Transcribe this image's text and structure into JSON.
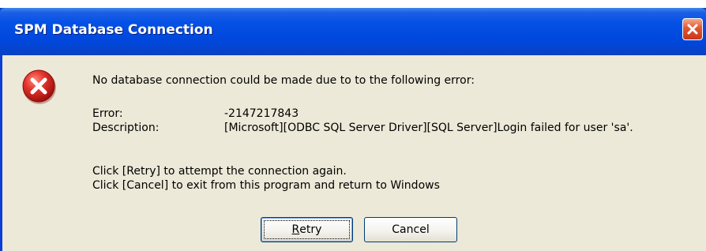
{
  "dialog": {
    "title": "SPM Database Connection",
    "close_icon": "close-icon",
    "error_icon": "error-icon",
    "message": "No database connection could be made due to to the following error:",
    "error_label": "Error:",
    "error_value": "-2147217843",
    "description_label": "Description:",
    "description_value": "[Microsoft][ODBC SQL Server Driver][SQL Server]Login failed for user 'sa'.",
    "instruction_retry": "Click [Retry] to attempt the connection again.",
    "instruction_cancel": "Click [Cancel] to exit from this program and return to Windows",
    "buttons": {
      "retry_prefix": "R",
      "retry_rest": "etry",
      "cancel": "Cancel"
    }
  },
  "colors": {
    "title_bar": "#0047dc",
    "dialog_background": "#ece9d8",
    "close_button": "#e2552f",
    "error_icon": "#d8261e"
  }
}
